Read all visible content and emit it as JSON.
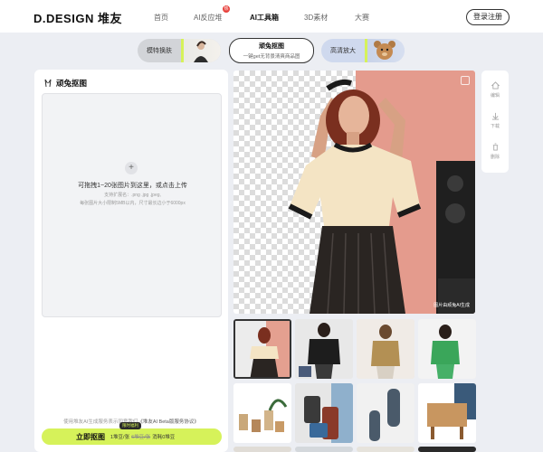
{
  "header": {
    "logo": "D.DESIGN 堆友",
    "nav": [
      {
        "label": "首页",
        "active": false
      },
      {
        "label": "AI反应堆",
        "active": false
      },
      {
        "label": "AI工具箱",
        "active": true
      },
      {
        "label": "3D素材",
        "active": false
      },
      {
        "label": "大赛",
        "active": false
      }
    ],
    "hot_badge": "热",
    "login_label": "登录注册"
  },
  "tools": [
    {
      "label": "模特换肤"
    },
    {
      "label": "顽兔抠图",
      "subtitle": "一键get无背景清爽商品图",
      "selected": true
    },
    {
      "label": "高清放大"
    }
  ],
  "left_panel": {
    "title": "顽兔抠图",
    "upload_main": "可拖拽1~20张图片到这里，或点击上传",
    "upload_formats": "支持扩展名：.png .jpg .jpeg,",
    "upload_limits": "每张图片大小限制5MB以内，尺寸最长边小于6000px",
    "agreement_prefix": "使用堆友AI生成服务表示同意我们",
    "agreement_link": "《堆友AI Beta版服务协议》",
    "cta_label": "立即抠图",
    "cta_badge": "限时福利",
    "cta_price_now": "1堆豆/张",
    "cta_price_old": "6堆豆/张",
    "cta_total": "消耗0堆豆"
  },
  "preview": {
    "watermark": "图片由顽兔AI生成"
  },
  "actions": [
    {
      "label": "编辑",
      "icon": "home-icon"
    },
    {
      "label": "下载",
      "icon": "download-icon"
    },
    {
      "label": "删除",
      "icon": "trash-icon"
    }
  ],
  "colors": {
    "accent": "#d6f25a",
    "pink": "#e49b8d",
    "page_bg": "#eceef3"
  }
}
